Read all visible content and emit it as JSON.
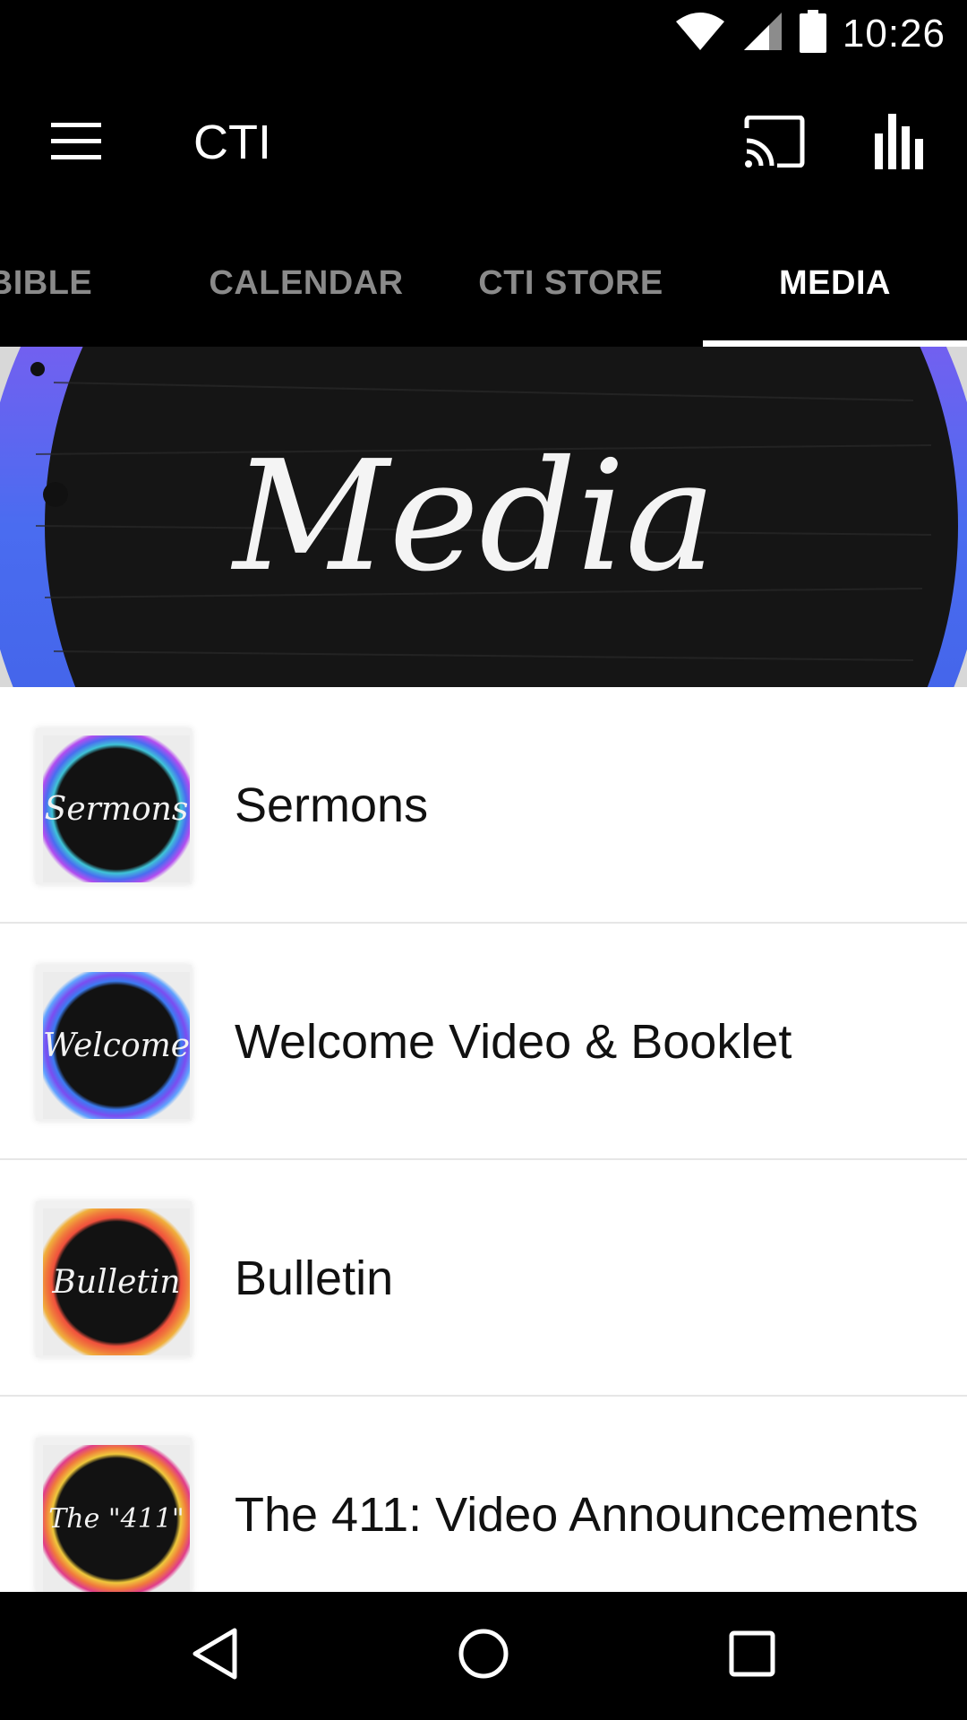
{
  "status_bar": {
    "time": "10:26",
    "icons": [
      "wifi-icon",
      "signal-icon",
      "battery-icon"
    ]
  },
  "app_bar": {
    "title": "CTI",
    "menu_icon": "hamburger-menu-icon",
    "actions": [
      "cast-icon",
      "bar-chart-icon"
    ]
  },
  "tabs": [
    {
      "label": "BIBLE",
      "active": false
    },
    {
      "label": "CALENDAR",
      "active": false
    },
    {
      "label": "CTI STORE",
      "active": false
    },
    {
      "label": "MEDIA",
      "active": true
    }
  ],
  "banner": {
    "text": "Media"
  },
  "list": {
    "items": [
      {
        "label": "Sermons",
        "thumb_text": "Sermons",
        "ring_colors": [
          "#3fc4d8",
          "#4a6cf0",
          "#b24df0"
        ]
      },
      {
        "label": "Welcome Video & Booklet",
        "thumb_text": "Welcome",
        "ring_colors": [
          "#3c7bf2",
          "#7b4df0",
          "#5fa2ff"
        ]
      },
      {
        "label": "Bulletin",
        "thumb_text": "Bulletin",
        "ring_colors": [
          "#f0503c",
          "#f07a3c",
          "#f0b03c"
        ]
      },
      {
        "label": "The 411: Video Announcements",
        "thumb_text": "The \"411\"",
        "ring_colors": [
          "#f0c83c",
          "#f07a3c",
          "#e03c8a"
        ]
      }
    ]
  },
  "nav_bar": {
    "buttons": [
      "back-icon",
      "home-icon",
      "recents-icon"
    ]
  },
  "colors": {
    "background": "#000000",
    "tab_inactive": "#8a8a8a",
    "tab_active": "#ffffff",
    "list_bg": "#ffffff",
    "text": "#111111"
  }
}
